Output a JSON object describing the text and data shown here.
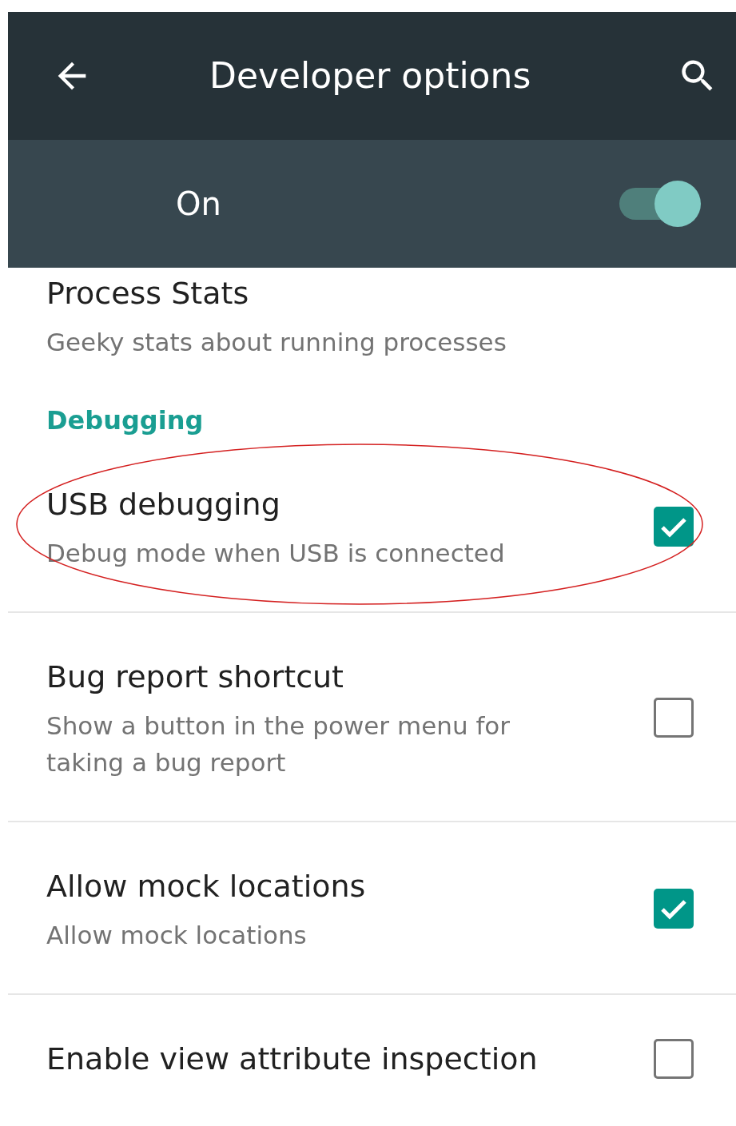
{
  "toolbar": {
    "title": "Developer options"
  },
  "master_switch": {
    "label": "On",
    "on": true
  },
  "items": [
    {
      "kind": "setting",
      "title": "Process Stats",
      "summary": "Geeky stats about running processes"
    },
    {
      "kind": "header",
      "title": "Debugging"
    },
    {
      "kind": "checkbox",
      "title": "USB debugging",
      "summary": "Debug mode when USB is connected",
      "checked": true,
      "circled": true
    },
    {
      "kind": "checkbox",
      "title": "Bug report shortcut",
      "summary": "Show a button in the power menu for taking a bug report",
      "checked": false
    },
    {
      "kind": "checkbox",
      "title": "Allow mock locations",
      "summary": "Allow mock locations",
      "checked": true
    },
    {
      "kind": "checkbox",
      "title": "Enable view attribute inspection",
      "checked": false
    }
  ]
}
